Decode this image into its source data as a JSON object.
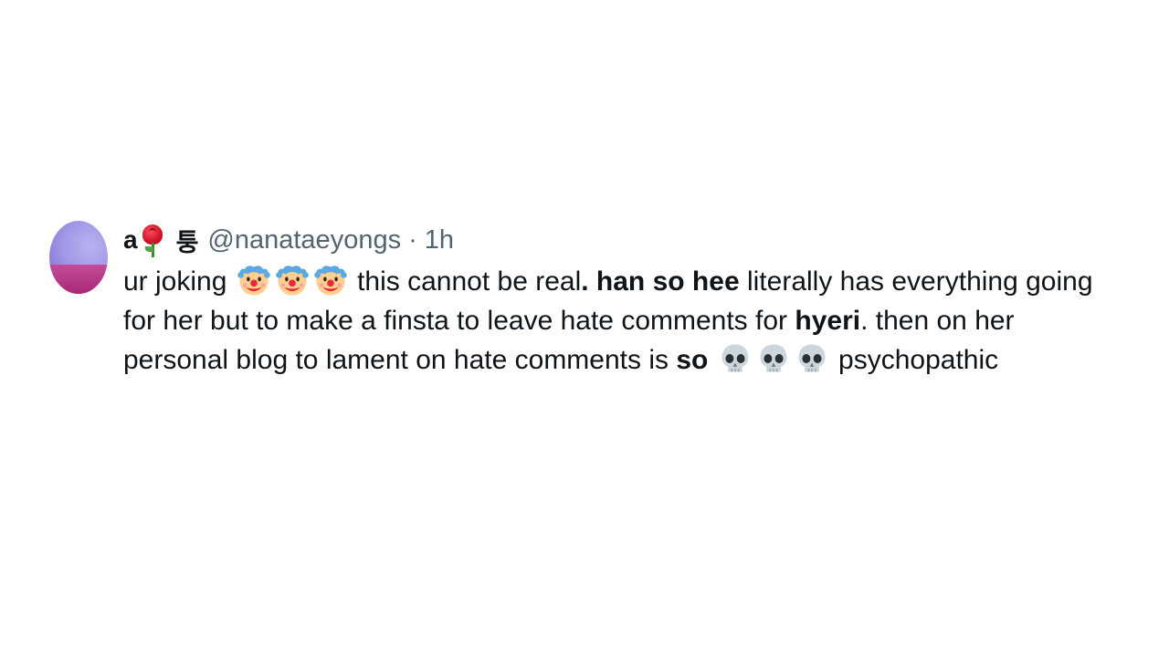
{
  "tweet": {
    "author": {
      "name_letter": "a",
      "name_emoji": "rose",
      "name_korean": "퉁",
      "handle": "@nanataeyongs",
      "separator": "·",
      "timestamp": "1h"
    },
    "body": {
      "segment_1": "ur joking",
      "emoji_1": "clown-face",
      "segment_2": "this cannot be real",
      "segment_3": ". ",
      "bold_1": "han so hee",
      "segment_4": " literally has everything going for her but to make a finsta to leave hate comments for ",
      "bold_2": "hyeri",
      "segment_5": ". then on her personal blog to lament on hate comments is ",
      "bold_3": "so",
      "emoji_2": "skull",
      "segment_6": "psychopathic"
    }
  },
  "colors": {
    "text": "#0f1419",
    "muted": "#536471",
    "background": "#ffffff"
  }
}
